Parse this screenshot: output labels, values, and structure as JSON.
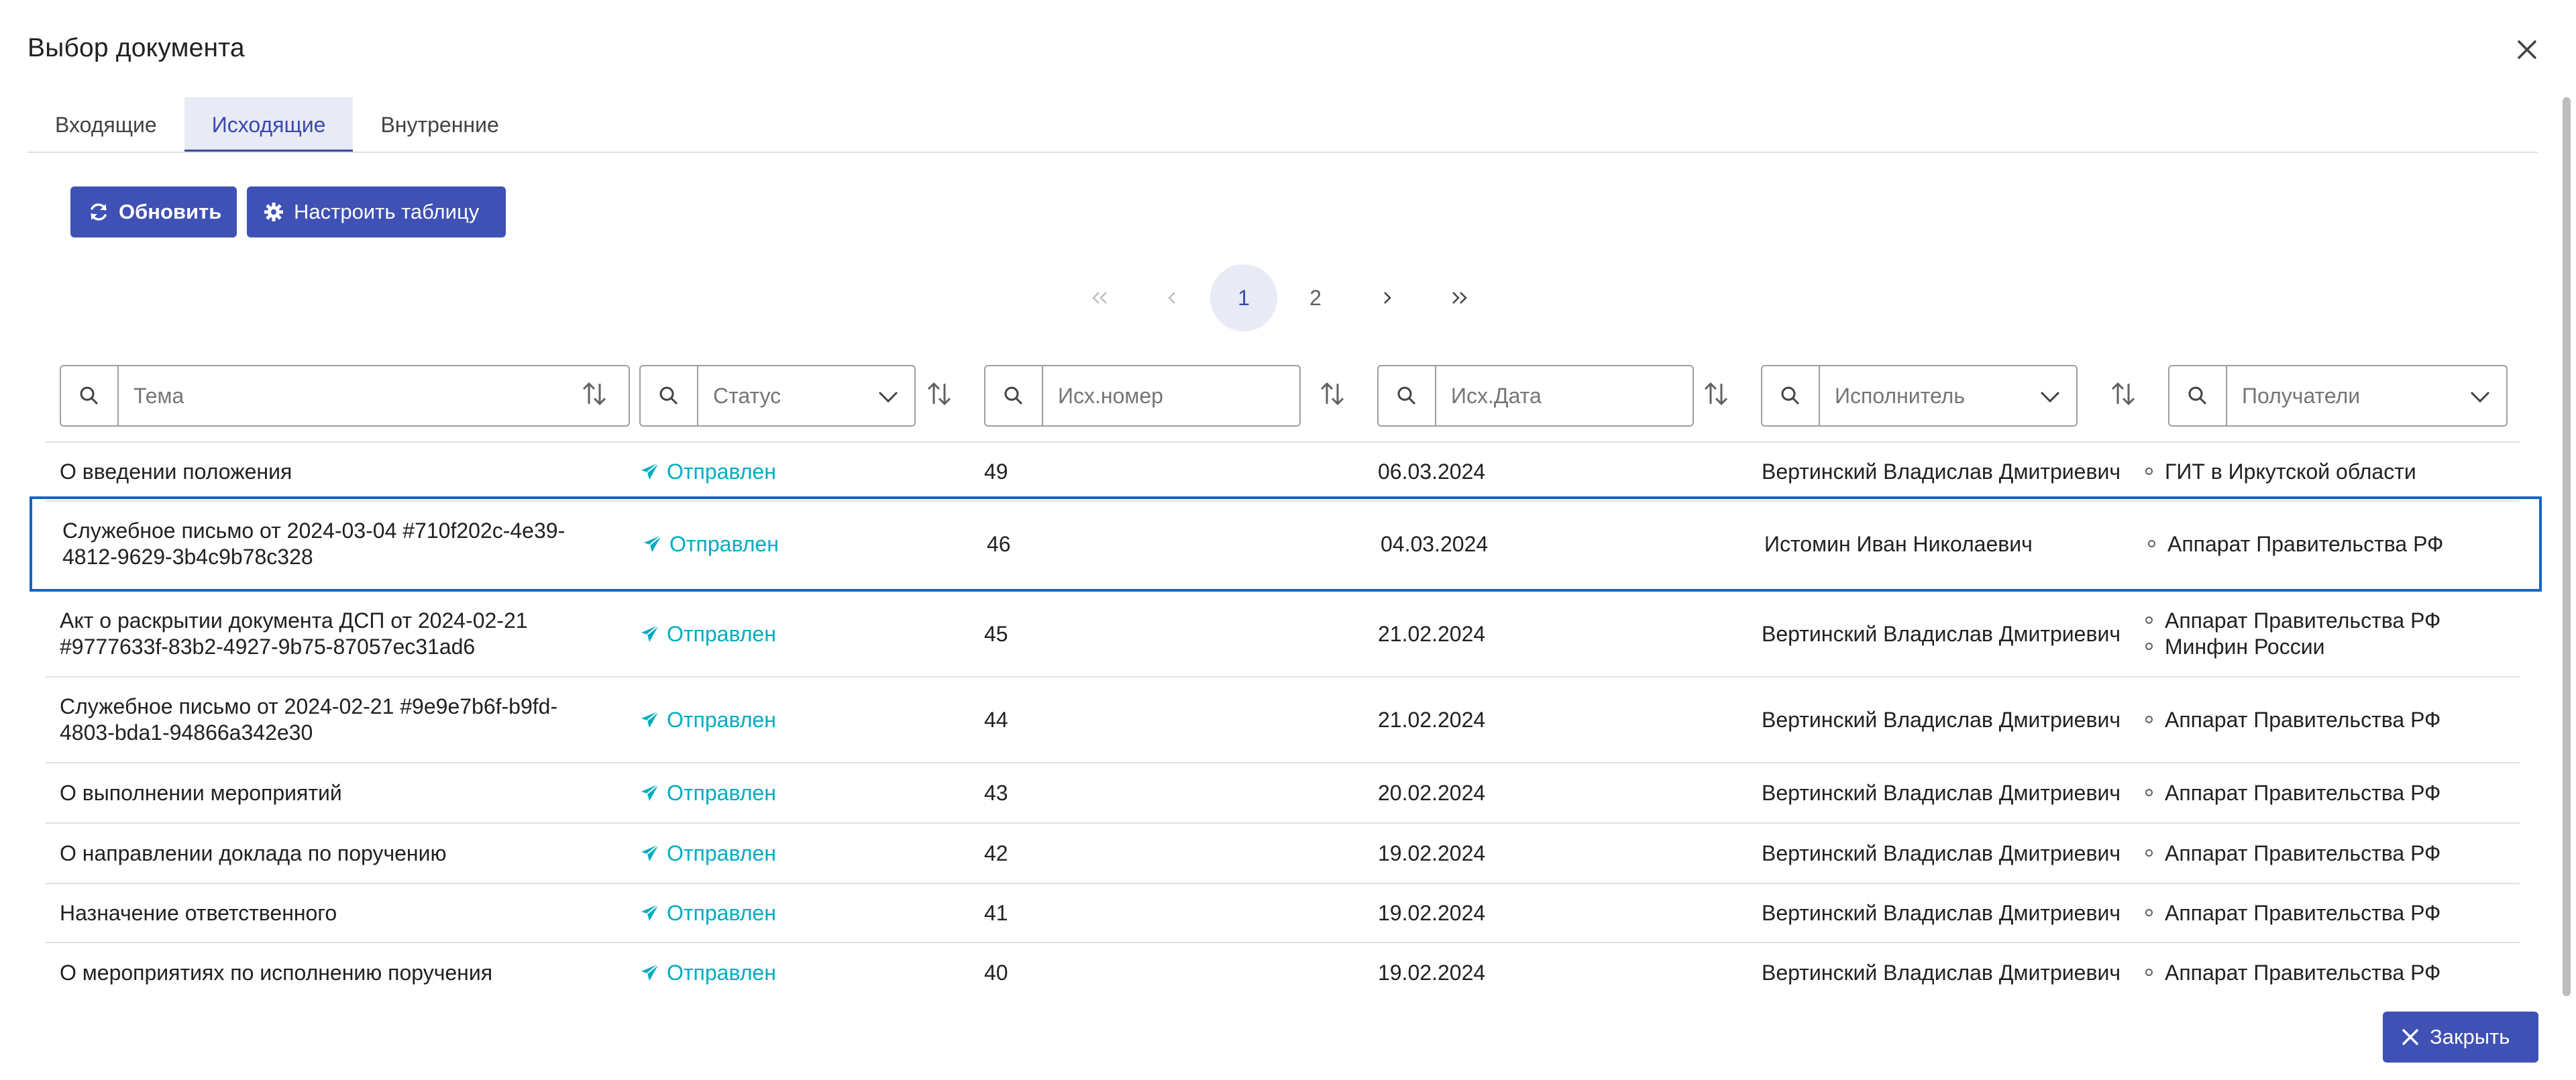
{
  "dialog": {
    "title": "Выбор документа",
    "close_button_label": "Закрыть"
  },
  "tabs": [
    {
      "label": "Входящие",
      "active": false
    },
    {
      "label": "Исходящие",
      "active": true
    },
    {
      "label": "Внутренние",
      "active": false
    }
  ],
  "toolbar": {
    "refresh_label": "Обновить",
    "configure_label": "Настроить таблицу"
  },
  "pagination": {
    "pages": [
      "1",
      "2"
    ],
    "current": "1"
  },
  "filters": {
    "topic": {
      "placeholder": "Тема"
    },
    "status": {
      "placeholder": "Статус"
    },
    "number": {
      "placeholder": "Исх.номер"
    },
    "date": {
      "placeholder": "Исх.Дата"
    },
    "executor": {
      "placeholder": "Исполнитель"
    },
    "recipients": {
      "placeholder": "Получатели"
    }
  },
  "rows": [
    {
      "topic": "О введении положения",
      "status": "Отправлен",
      "number": "49",
      "date": "06.03.2024",
      "executor": "Вертинский Владислав Дмитриевич",
      "recipients": [
        "ГИТ в Иркутской области"
      ]
    },
    {
      "topic": "Служебное письмо от 2024-03-04 #710f202c-4e39-4812-9629-3b4c9b78c328",
      "status": "Отправлен",
      "number": "46",
      "date": "04.03.2024",
      "executor": "Истомин Иван Николаевич",
      "recipients": [
        "Аппарат Правительства РФ"
      ]
    },
    {
      "topic": "Акт о раскрытии документа ДСП от 2024-02-21 #9777633f-83b2-4927-9b75-87057ec31ad6",
      "status": "Отправлен",
      "number": "45",
      "date": "21.02.2024",
      "executor": "Вертинский Владислав Дмитриевич",
      "recipients": [
        "Аппарат Правительства РФ",
        "Минфин России"
      ]
    },
    {
      "topic": "Служебное письмо от 2024-02-21 #9e9e7b6f-b9fd-4803-bda1-94866a342e30",
      "status": "Отправлен",
      "number": "44",
      "date": "21.02.2024",
      "executor": "Вертинский Владислав Дмитриевич",
      "recipients": [
        "Аппарат Правительства РФ"
      ]
    },
    {
      "topic": "О выполнении мероприятий",
      "status": "Отправлен",
      "number": "43",
      "date": "20.02.2024",
      "executor": "Вертинский Владислав Дмитриевич",
      "recipients": [
        "Аппарат Правительства РФ"
      ]
    },
    {
      "topic": "О направлении доклада по поручению",
      "status": "Отправлен",
      "number": "42",
      "date": "19.02.2024",
      "executor": "Вертинский Владислав Дмитриевич",
      "recipients": [
        "Аппарат Правительства РФ"
      ]
    },
    {
      "topic": "Назначение ответственного",
      "status": "Отправлен",
      "number": "41",
      "date": "19.02.2024",
      "executor": "Вертинский Владислав Дмитриевич",
      "recipients": [
        "Аппарат Правительства РФ"
      ]
    },
    {
      "topic": "О мероприятиях по исполнению поручения",
      "status": "Отправлен",
      "number": "40",
      "date": "19.02.2024",
      "executor": "Вертинский Владислав Дмитриевич",
      "recipients": [
        "Аппарат Правительства РФ"
      ]
    }
  ],
  "selected_row": 1,
  "colors": {
    "primary": "#3f51b5",
    "tab_active": "#3949ab",
    "status": "#00acc1",
    "selection": "#1565c0"
  }
}
